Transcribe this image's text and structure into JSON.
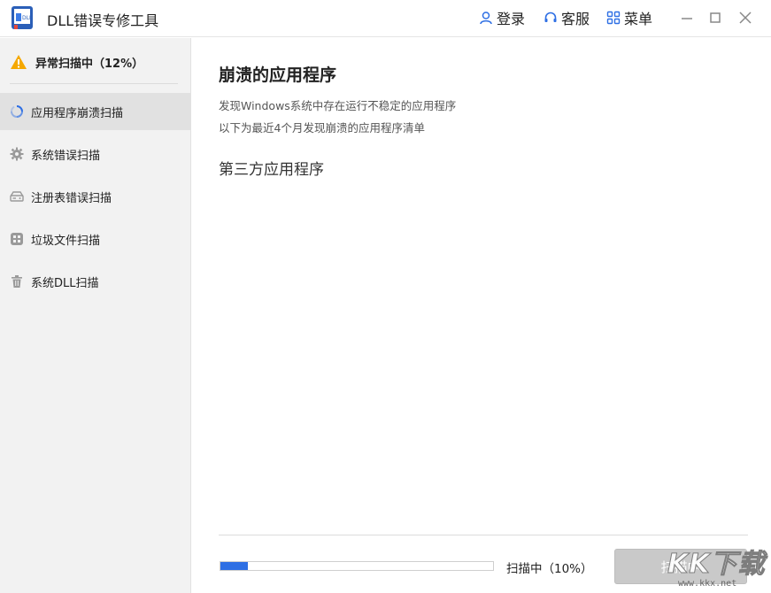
{
  "app": {
    "title": "DLL错误专修工具"
  },
  "topbar": {
    "login_label": "登录",
    "service_label": "客服",
    "menu_label": "菜单"
  },
  "sidebar": {
    "status_label": "异常扫描中（12%）",
    "items": [
      {
        "label": "应用程序崩溃扫描",
        "icon": "spinner-icon",
        "active": true
      },
      {
        "label": "系统错误扫描",
        "icon": "gear-icon",
        "active": false
      },
      {
        "label": "注册表错误扫描",
        "icon": "registry-icon",
        "active": false
      },
      {
        "label": "垃圾文件扫描",
        "icon": "grid-icon",
        "active": false
      },
      {
        "label": "系统DLL扫描",
        "icon": "trash-icon",
        "active": false
      }
    ]
  },
  "main": {
    "title": "崩溃的应用程序",
    "desc_line1": "发现Windows系统中存在运行不稳定的应用程序",
    "desc_line2": "以下为最近4个月发现崩溃的应用程序清单",
    "section_title": "第三方应用程序",
    "progress_label": "扫描中（10%）",
    "progress_value": 0.1,
    "scan_button_label": "扫描中"
  },
  "watermark": {
    "text": "KK下载",
    "url": "www.kkx.net"
  },
  "colors": {
    "accent": "#2e6fe4",
    "warning": "#f5a800",
    "sidebar_bg": "#f2f2f2",
    "active_bg": "#e1e1e1",
    "button_disabled": "#c9c9c9"
  }
}
